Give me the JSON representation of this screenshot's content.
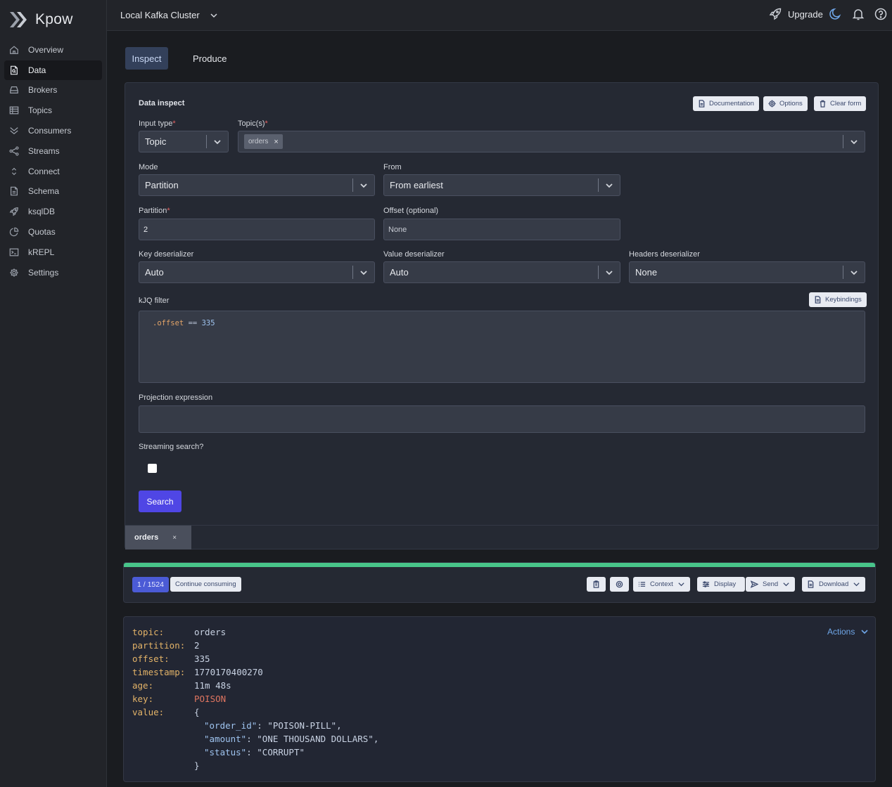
{
  "brand": {
    "name": "Kpow"
  },
  "sidebar": {
    "items": [
      {
        "label": "Overview",
        "icon": "home-icon"
      },
      {
        "label": "Data",
        "icon": "document-icon",
        "active": true
      },
      {
        "label": "Brokers",
        "icon": "server-icon"
      },
      {
        "label": "Topics",
        "icon": "table-icon"
      },
      {
        "label": "Consumers",
        "icon": "chevrons-icon"
      },
      {
        "label": "Streams",
        "icon": "share-icon"
      },
      {
        "label": "Connect",
        "icon": "connect-icon"
      },
      {
        "label": "Schema",
        "icon": "file-icon"
      },
      {
        "label": "ksqlDB",
        "icon": "rocket-icon"
      },
      {
        "label": "Quotas",
        "icon": "pie-icon"
      },
      {
        "label": "kREPL",
        "icon": "terminal-icon"
      },
      {
        "label": "Settings",
        "icon": "gear-icon"
      }
    ]
  },
  "topbar": {
    "cluster": "Local Kafka Cluster",
    "upgrade": "Upgrade"
  },
  "tabs": {
    "inspect": "Inspect",
    "produce": "Produce"
  },
  "form": {
    "title": "Data inspect",
    "buttons": {
      "documentation": "Documentation",
      "options": "Options",
      "clear": "Clear form",
      "keybindings": "Keybindings"
    },
    "input_type": {
      "label": "Input type",
      "value": "Topic"
    },
    "topics": {
      "label": "Topic(s)",
      "chips": [
        "orders"
      ]
    },
    "mode": {
      "label": "Mode",
      "value": "Partition"
    },
    "from": {
      "label": "From",
      "value": "From earliest"
    },
    "partition": {
      "label": "Partition",
      "value": "2"
    },
    "offset": {
      "label": "Offset (optional)",
      "placeholder": "None"
    },
    "key_deser": {
      "label": "Key deserializer",
      "value": "Auto"
    },
    "value_deser": {
      "label": "Value deserializer",
      "value": "Auto"
    },
    "headers_deser": {
      "label": "Headers deserializer",
      "value": "None"
    },
    "kjq": {
      "label": "kJQ filter",
      "field": ".offset",
      "op": "==",
      "num": "335"
    },
    "projection": {
      "label": "Projection expression"
    },
    "streaming": {
      "label": "Streaming search?"
    },
    "search": "Search",
    "result_tab": "orders"
  },
  "results": {
    "progress_percent": 100,
    "count": "1 / 1524",
    "continue": "Continue consuming",
    "context": "Context",
    "display": "Display",
    "send": "Send",
    "download": "Download"
  },
  "record": {
    "actions": "Actions",
    "fields": [
      {
        "key": "topic:",
        "value": "orders"
      },
      {
        "key": "partition:",
        "value": "2"
      },
      {
        "key": "offset:",
        "value": "335"
      },
      {
        "key": "timestamp:",
        "value": "1770170400270"
      },
      {
        "key": "age:",
        "value": "11m 48s"
      },
      {
        "key": "key:",
        "value": "POISON"
      },
      {
        "key": "value:",
        "value": "{"
      }
    ],
    "json": [
      {
        "k": "\"order_id\"",
        "v": "\"POISON-PILL\","
      },
      {
        "k": "\"amount\"",
        "v": "\"ONE THOUSAND DOLLARS\","
      },
      {
        "k": "\"status\"",
        "v": "\"CORRUPT\""
      }
    ],
    "close": "}"
  },
  "colors": {
    "accent": "#4f46e5",
    "progress": "#48c58a",
    "key": "#e3b368",
    "poison": "#e07560"
  }
}
